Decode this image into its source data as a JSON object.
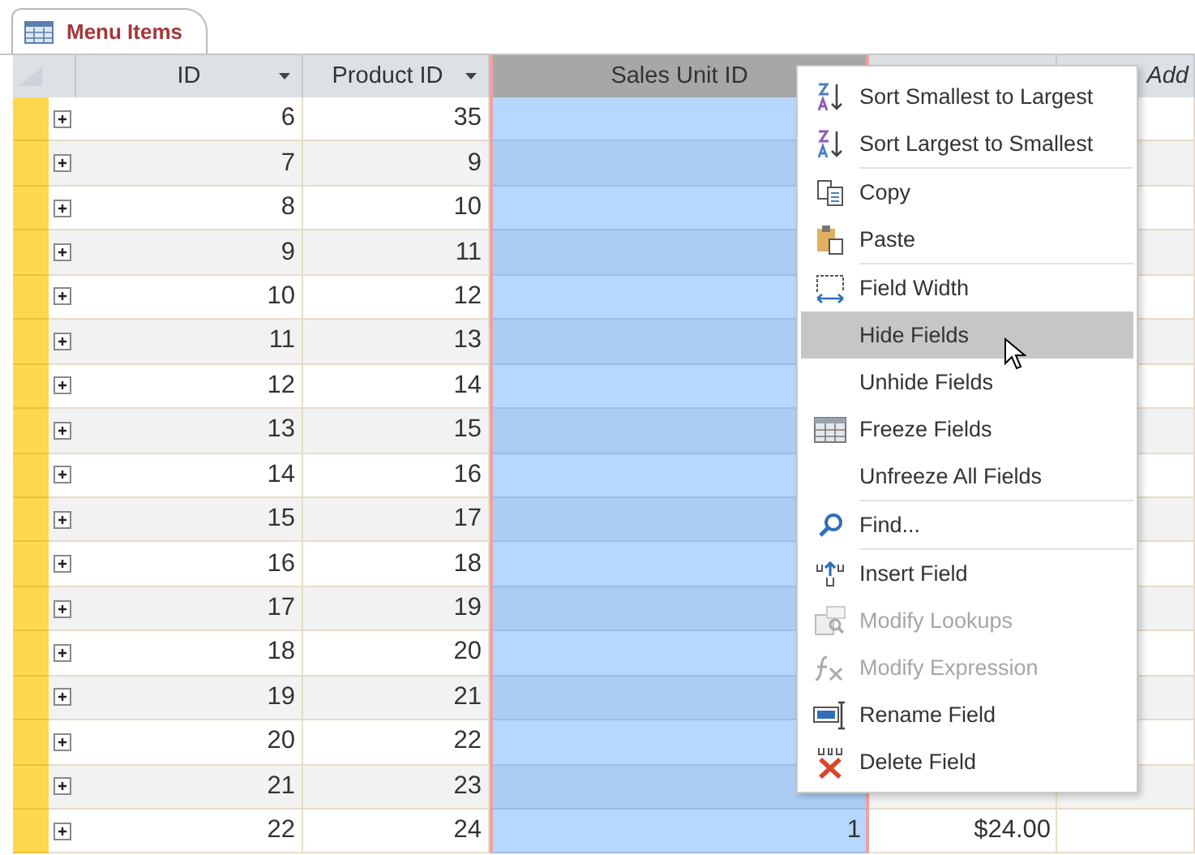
{
  "tab": {
    "title": "Menu Items"
  },
  "columns": [
    {
      "label": "ID",
      "filter_arrow": true,
      "selected": false
    },
    {
      "label": "Product ID",
      "filter_arrow": true,
      "selected": false
    },
    {
      "label": "Sales Unit ID",
      "filter_arrow": false,
      "selected": true
    },
    {
      "selected": false
    },
    {
      "label": "Add",
      "filter_arrow": false,
      "selected": false
    }
  ],
  "rows": [
    {
      "id": "6",
      "product_id": "35"
    },
    {
      "id": "7",
      "product_id": "9"
    },
    {
      "id": "8",
      "product_id": "10"
    },
    {
      "id": "9",
      "product_id": "11"
    },
    {
      "id": "10",
      "product_id": "12"
    },
    {
      "id": "11",
      "product_id": "13"
    },
    {
      "id": "12",
      "product_id": "14"
    },
    {
      "id": "13",
      "product_id": "15"
    },
    {
      "id": "14",
      "product_id": "16"
    },
    {
      "id": "15",
      "product_id": "17"
    },
    {
      "id": "16",
      "product_id": "18"
    },
    {
      "id": "17",
      "product_id": "19"
    },
    {
      "id": "18",
      "product_id": "20"
    },
    {
      "id": "19",
      "product_id": "21"
    },
    {
      "id": "20",
      "product_id": "22"
    },
    {
      "id": "21",
      "product_id": "23"
    },
    {
      "id": "22",
      "product_id": "24",
      "sales_unit_id": "1",
      "price": "$24.00"
    }
  ],
  "menu": {
    "groups": [
      {
        "items": [
          {
            "label": "Sort Smallest to Largest",
            "kind": "sortasc",
            "selected": false,
            "disabled": false
          },
          {
            "label": "Sort Largest to Smallest",
            "kind": "sortdesc",
            "selected": false,
            "disabled": false
          }
        ]
      },
      {
        "items": [
          {
            "label": "Copy",
            "kind": "copy",
            "selected": false,
            "disabled": false
          },
          {
            "label": "Paste",
            "kind": "paste",
            "selected": false,
            "disabled": false
          }
        ]
      },
      {
        "items": [
          {
            "label": "Field Width",
            "kind": "width",
            "selected": false,
            "disabled": false
          },
          {
            "label": "Hide Fields",
            "kind": "plain",
            "selected": true,
            "disabled": false
          },
          {
            "label": "Unhide Fields",
            "kind": "plain",
            "selected": false,
            "disabled": false
          },
          {
            "label": "Freeze Fields",
            "kind": "freeze",
            "selected": false,
            "disabled": false
          },
          {
            "label": "Unfreeze All Fields",
            "kind": "plain",
            "selected": false,
            "disabled": false
          }
        ]
      },
      {
        "items": [
          {
            "label": "Find...",
            "kind": "find",
            "selected": false,
            "disabled": false
          }
        ]
      },
      {
        "items": [
          {
            "label": "Insert Field",
            "kind": "insert",
            "selected": false,
            "disabled": false
          },
          {
            "label": "Modify Lookups",
            "kind": "lookup",
            "selected": false,
            "disabled": true
          },
          {
            "label": "Modify Expression",
            "kind": "expression",
            "selected": false,
            "disabled": true
          },
          {
            "label": "Rename Field",
            "kind": "rename",
            "selected": false,
            "disabled": false
          },
          {
            "label": "Delete Field",
            "kind": "delete",
            "selected": false,
            "disabled": false
          }
        ]
      }
    ]
  }
}
